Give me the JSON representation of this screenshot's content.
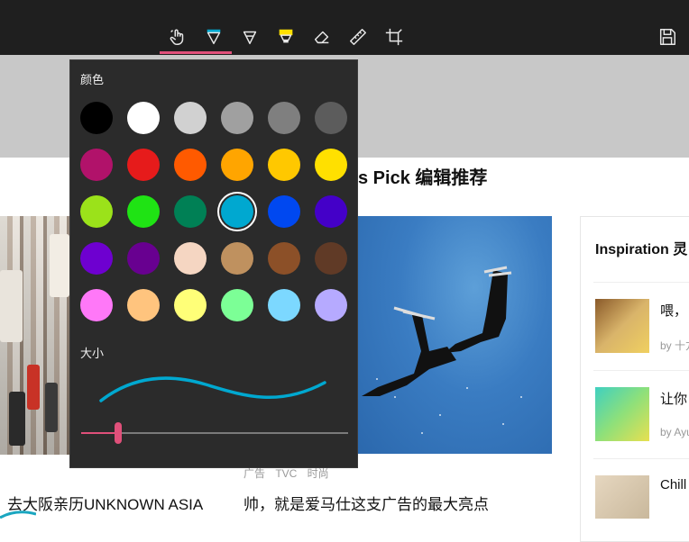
{
  "toolbar": {
    "tools": [
      {
        "icon": "touch-writing-icon",
        "active": true
      },
      {
        "icon": "ballpoint-pen-icon",
        "active": false
      },
      {
        "icon": "pencil-icon",
        "active": false
      },
      {
        "icon": "highlighter-icon",
        "active": false
      },
      {
        "icon": "eraser-icon",
        "active": false
      },
      {
        "icon": "ruler-icon",
        "active": false
      },
      {
        "icon": "crop-icon",
        "active": false
      }
    ],
    "save_icon": "save-icon",
    "accent": "#e0507a"
  },
  "popup": {
    "color_label": "颜色",
    "size_label": "大小",
    "colors": [
      "#000000",
      "#ffffff",
      "#d1d1d1",
      "#a0a0a0",
      "#7f7f7f",
      "#5c5c5c",
      "#b1126a",
      "#e61b1b",
      "#ff5a00",
      "#ffa500",
      "#ffc800",
      "#ffe000",
      "#9be21a",
      "#1fe314",
      "#008055",
      "#00a8d0",
      "#0048f0",
      "#4400c8",
      "#6e00d0",
      "#680090",
      "#f5d6c2",
      "#bf915f",
      "#8c5028",
      "#603a26",
      "#ff78f8",
      "#ffc47e",
      "#ffff78",
      "#7cff96",
      "#7cd8ff",
      "#b6aaff"
    ],
    "selected_color": "#00a8d0",
    "size_value": 0.14
  },
  "page": {
    "section_title": "s Pick 编辑推荐",
    "tags": "广告   TVC   时尚",
    "caption_left": "去大阪亲历UNKNOWN ASIA",
    "caption_mid": "帅，就是爱马仕这支广告的最大亮点",
    "sidebar": {
      "title": "Inspiration 灵",
      "items": [
        {
          "text": "喂，",
          "by": "by 十方"
        },
        {
          "text": "让你",
          "by": "by Ayu"
        },
        {
          "text": "Chill",
          "by": ""
        }
      ]
    }
  }
}
